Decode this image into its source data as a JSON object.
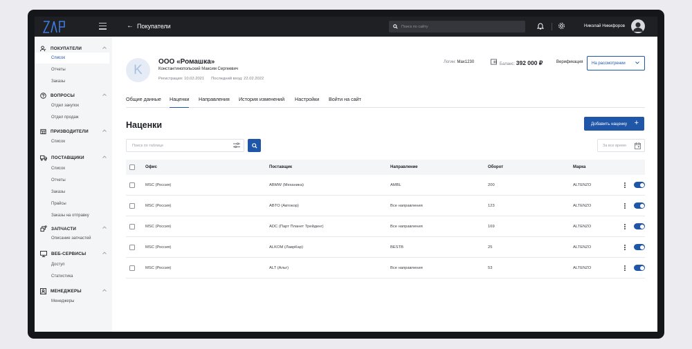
{
  "app": {
    "logo": "ZAP"
  },
  "topbar": {
    "page_title": "Покупатели",
    "search_placeholder": "Поиск по сайту",
    "user_name": "Николай Никифоров"
  },
  "sidebar": {
    "sections": [
      {
        "label": "ПОКУПАТЕЛИ",
        "icon": "users-icon",
        "items": [
          "Список",
          "Отчеты",
          "Заказы"
        ],
        "active": "Список"
      },
      {
        "label": "ВОПРОСЫ",
        "icon": "question-icon",
        "items": [
          "Отдел закупок",
          "Отдел продаж"
        ]
      },
      {
        "label": "ПРИЗВОДИТЕЛИ",
        "icon": "factory-icon",
        "items": [
          "Список"
        ]
      },
      {
        "label": "ПОСТАВЩИКИ",
        "icon": "truck-icon",
        "items": [
          "Список",
          "Отчеты",
          "Заказы",
          "Прайсы",
          "Заказы на отправку"
        ]
      },
      {
        "label": "ЗАПЧАСТИ",
        "icon": "parts-icon",
        "items": [
          "Описание запчастей"
        ]
      },
      {
        "label": "ВЕБ-СЕРВИСЫ",
        "icon": "monitor-icon",
        "items": [
          "Доступ",
          "Статистика"
        ]
      },
      {
        "label": "МЕНЕДЖЕРЫ",
        "icon": "id-card-icon",
        "items": [
          "Менеджеры"
        ]
      }
    ]
  },
  "profile": {
    "avatar_letter": "K",
    "org_name": "ООО «Ромашка»",
    "person": "Константинопольский Максим Сергеевич",
    "registration": "Регистрация: 10.02.2021",
    "last_login": "Последний вход: 22.02.2022",
    "login_label": "Логин:",
    "login_value": "Max1230",
    "balance_label": "Баланс:",
    "balance_value": "392 000 ₽",
    "verification_label": "Верификация",
    "verification_status": "На рассмотрении"
  },
  "tabs": [
    "Общие данные",
    "Наценки",
    "Направления",
    "История изменений",
    "Настройки",
    "Войти на сайт"
  ],
  "active_tab": "Наценки",
  "section": {
    "title": "Наценки",
    "add_button": "Добавить наценку",
    "search_placeholder": "Поиск по таблице",
    "period": "За все время"
  },
  "table": {
    "columns": [
      "Офис",
      "Поставщик",
      "Направление",
      "Оборот",
      "Марка"
    ],
    "rows": [
      {
        "office": "MSC (Россия)",
        "supplier": "ABMW (Механика)",
        "direction": "AMBL",
        "turnover": "200",
        "brand": "ALTENZO",
        "enabled": true
      },
      {
        "office": "MSC (Россия)",
        "supplier": "ABTO (Автокор)",
        "direction": "Все направления",
        "turnover": "123",
        "brand": "ALTENZO",
        "enabled": true
      },
      {
        "office": "MSC (Россия)",
        "supplier": "ADC (Парт Планет Трейдинг)",
        "direction": "Все направления",
        "turnover": "169",
        "brand": "ALTENZO",
        "enabled": true
      },
      {
        "office": "MSC (Россия)",
        "supplier": "ALKOM (ЛаврКар)",
        "direction": "BESTB",
        "turnover": "25",
        "brand": "ALTENZO",
        "enabled": true
      },
      {
        "office": "MSC (Россия)",
        "supplier": "ALT (Альт)",
        "direction": "Все направления",
        "turnover": "53",
        "brand": "ALTENZO",
        "enabled": true
      }
    ]
  },
  "colors": {
    "accent": "#1f56a8",
    "topbar": "#1f2024",
    "sidebar": "#f4f5f7"
  }
}
